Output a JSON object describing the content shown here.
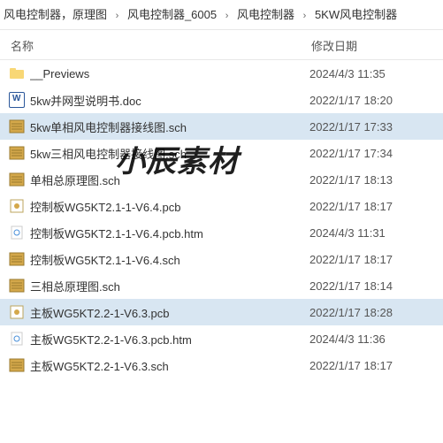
{
  "breadcrumb": {
    "items": [
      "风电控制器，原理图",
      "风电控制器_6005",
      "风电控制器",
      "5KW风电控制器"
    ]
  },
  "headers": {
    "name": "名称",
    "date": "修改日期"
  },
  "files": [
    {
      "icon": "folder",
      "name": "__Previews",
      "date": "2024/4/3 11:35",
      "selected": false
    },
    {
      "icon": "doc",
      "name": "5kw并网型说明书.doc",
      "date": "2022/1/17 18:20",
      "selected": false
    },
    {
      "icon": "sch",
      "name": "5kw单相风电控制器接线图.sch",
      "date": "2022/1/17 17:33",
      "selected": true
    },
    {
      "icon": "sch",
      "name": "5kw三相风电控制器接线图.sch",
      "date": "2022/1/17 17:34",
      "selected": false
    },
    {
      "icon": "sch",
      "name": "单相总原理图.sch",
      "date": "2022/1/17 18:13",
      "selected": false
    },
    {
      "icon": "pcb",
      "name": "控制板WG5KT2.1-1-V6.4.pcb",
      "date": "2022/1/17 18:17",
      "selected": false
    },
    {
      "icon": "htm",
      "name": "控制板WG5KT2.1-1-V6.4.pcb.htm",
      "date": "2024/4/3 11:31",
      "selected": false
    },
    {
      "icon": "sch",
      "name": "控制板WG5KT2.1-1-V6.4.sch",
      "date": "2022/1/17 18:17",
      "selected": false
    },
    {
      "icon": "sch",
      "name": "三相总原理图.sch",
      "date": "2022/1/17 18:14",
      "selected": false
    },
    {
      "icon": "pcb",
      "name": "主板WG5KT2.2-1-V6.3.pcb",
      "date": "2022/1/17 18:28",
      "selected": true
    },
    {
      "icon": "htm",
      "name": "主板WG5KT2.2-1-V6.3.pcb.htm",
      "date": "2024/4/3 11:36",
      "selected": false
    },
    {
      "icon": "sch",
      "name": "主板WG5KT2.2-1-V6.3.sch",
      "date": "2022/1/17 18:17",
      "selected": false
    }
  ],
  "watermark": "小辰素材"
}
